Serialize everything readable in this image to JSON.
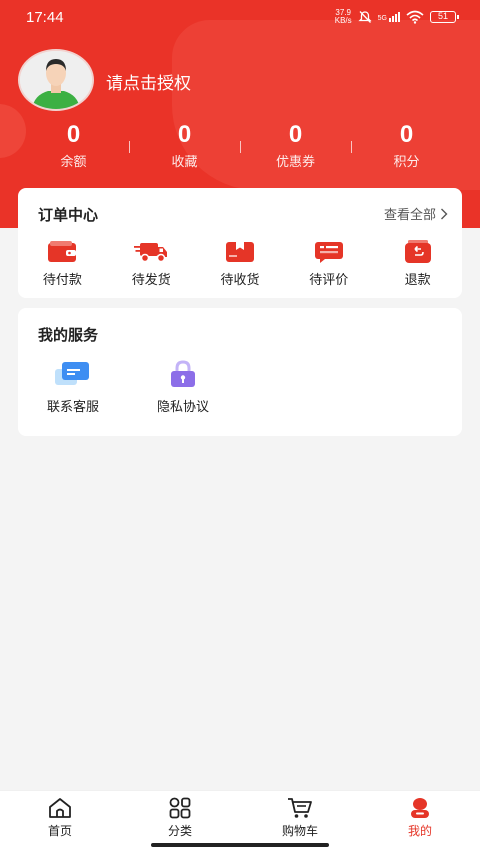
{
  "status_bar": {
    "time": "17:44",
    "net_speed_value": "37.9",
    "net_speed_unit": "KB/s",
    "network": "5G",
    "battery": "51"
  },
  "profile": {
    "username": "请点击授权"
  },
  "stats": [
    {
      "value": "0",
      "label": "余额"
    },
    {
      "value": "0",
      "label": "收藏"
    },
    {
      "value": "0",
      "label": "优惠券"
    },
    {
      "value": "0",
      "label": "积分"
    }
  ],
  "orders": {
    "title": "订单中心",
    "see_all": "查看全部",
    "items": [
      {
        "label": "待付款",
        "icon": "wallet-icon"
      },
      {
        "label": "待发货",
        "icon": "truck-icon"
      },
      {
        "label": "待收货",
        "icon": "box-icon"
      },
      {
        "label": "待评价",
        "icon": "comment-icon"
      },
      {
        "label": "退款",
        "icon": "refund-icon"
      }
    ]
  },
  "services": {
    "title": "我的服务",
    "items": [
      {
        "label": "联系客服",
        "icon": "chat-icon"
      },
      {
        "label": "隐私协议",
        "icon": "lock-icon"
      }
    ]
  },
  "tab_bar": {
    "items": [
      {
        "label": "首页",
        "icon": "home-icon",
        "active": false
      },
      {
        "label": "分类",
        "icon": "grid-icon",
        "active": false
      },
      {
        "label": "购物车",
        "icon": "cart-icon",
        "active": false
      },
      {
        "label": "我的",
        "icon": "user-icon",
        "active": true
      }
    ]
  },
  "colors": {
    "brand": "#ea3328",
    "accent_purple": "#8c6ee8",
    "accent_blue": "#4a8cf0"
  }
}
